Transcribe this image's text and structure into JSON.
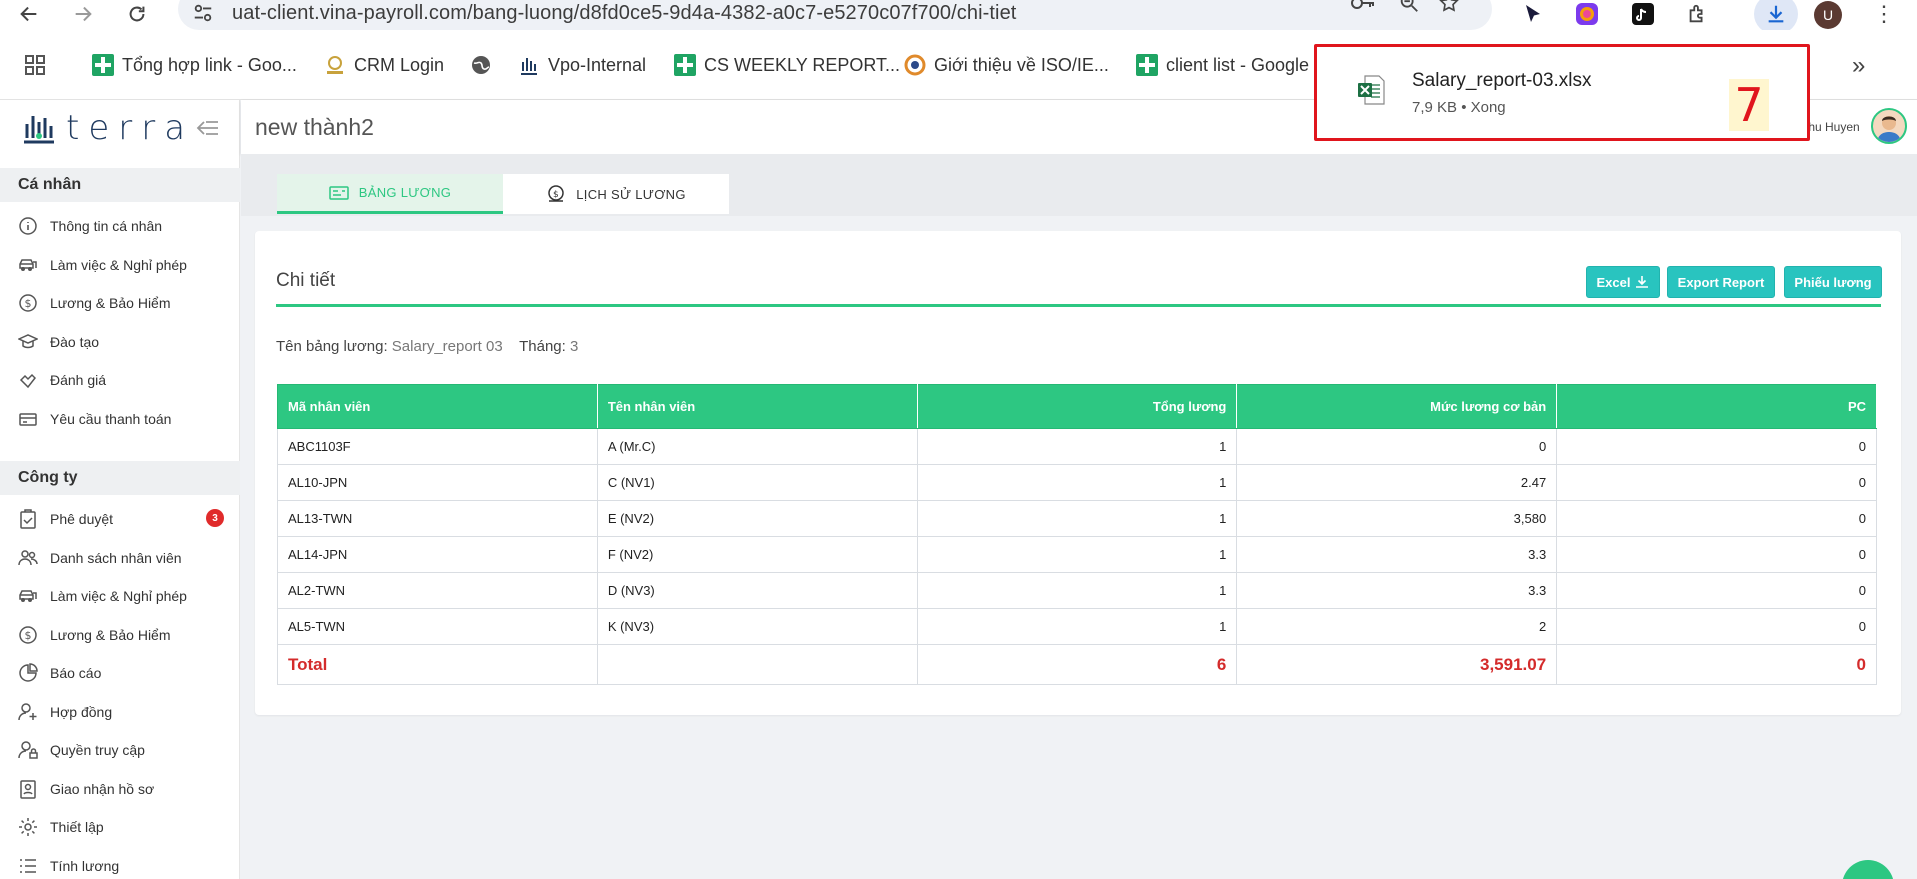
{
  "browser": {
    "url": "uat-client.vina-payroll.com/bang-luong/d8fd0ce5-9d4a-4382-a0c7-e5270c07f700/chi-tiet",
    "profile_initial": "U",
    "bookmarks": [
      {
        "label": "Tổng hợp link - Goo...",
        "icon": "sheets-icon"
      },
      {
        "label": "CRM Login",
        "icon": "crm-icon"
      },
      {
        "label": "",
        "icon": "globe-icon"
      },
      {
        "label": "Vpo-Internal",
        "icon": "terra-icon"
      },
      {
        "label": "CS WEEKLY REPORT...",
        "icon": "sheets-icon"
      },
      {
        "label": "Giới thiệu về ISO/IE...",
        "icon": "iso-icon"
      },
      {
        "label": "client list - Google",
        "icon": "sheets-icon"
      }
    ]
  },
  "download": {
    "file_name": "Salary_report-03.xlsx",
    "meta": "7,9 KB • Xong",
    "count": "7"
  },
  "app": {
    "logo_text": "terra",
    "page_title": "new thành2",
    "user_name": "Thu Huyen",
    "accent": "#2dc782"
  },
  "sidebar": {
    "personal_title": "Cá nhân",
    "personal": [
      {
        "label": "Thông tin cá nhân",
        "icon": "info-icon"
      },
      {
        "label": "Làm việc & Nghỉ phép",
        "icon": "car-icon"
      },
      {
        "label": "Lương & Bảo Hiểm",
        "icon": "money-icon"
      },
      {
        "label": "Đào tạo",
        "icon": "graduation-icon"
      },
      {
        "label": "Đánh giá",
        "icon": "review-icon"
      },
      {
        "label": "Yêu cầu thanh toán",
        "icon": "payment-icon"
      }
    ],
    "company_title": "Công ty",
    "company": [
      {
        "label": "Phê duyệt",
        "icon": "approval-icon",
        "badge": "3"
      },
      {
        "label": "Danh sách nhân viên",
        "icon": "people-icon"
      },
      {
        "label": "Làm việc & Nghỉ phép",
        "icon": "car-icon"
      },
      {
        "label": "Lương & Bảo Hiểm",
        "icon": "money-icon"
      },
      {
        "label": "Báo cáo",
        "icon": "pie-icon"
      },
      {
        "label": "Hợp đồng",
        "icon": "add-user-icon"
      },
      {
        "label": "Quyền truy cập",
        "icon": "user-lock-icon"
      },
      {
        "label": "Giao nhận hồ sơ",
        "icon": "profile-card-icon"
      },
      {
        "label": "Thiết lập",
        "icon": "gear-icon"
      },
      {
        "label": "Tính lương",
        "icon": "list-icon"
      }
    ]
  },
  "tabs": [
    {
      "label": "BẢNG LƯƠNG",
      "icon": "payslip-icon",
      "active": true
    },
    {
      "label": "LỊCH SỬ LƯƠNG",
      "icon": "money-history-icon",
      "active": false
    }
  ],
  "detail": {
    "title": "Chi tiết",
    "buttons": {
      "excel": "Excel",
      "export": "Export Report",
      "payslip": "Phiếu lương"
    },
    "name_label": "Tên bảng lương:",
    "name_value": "Salary_report 03",
    "month_label": "Tháng:",
    "month_value": "3"
  },
  "table": {
    "headers": [
      "Mã nhân viên",
      "Tên nhân viên",
      "Tổng lương",
      "Mức lương cơ bản",
      "PC"
    ],
    "rows": [
      [
        "ABC1103F",
        "A (Mr.C)",
        "1",
        "0",
        "0"
      ],
      [
        "AL10-JPN",
        "C (NV1)",
        "1",
        "2.47",
        "0"
      ],
      [
        "AL13-TWN",
        "E (NV2)",
        "1",
        "3,580",
        "0"
      ],
      [
        "AL14-JPN",
        "F (NV2)",
        "1",
        "3.3",
        "0"
      ],
      [
        "AL2-TWN",
        "D (NV3)",
        "1",
        "3.3",
        "0"
      ],
      [
        "AL5-TWN",
        "K (NV3)",
        "1",
        "2",
        "0"
      ]
    ],
    "total": [
      "Total",
      "",
      "6",
      "3,591.07",
      "0"
    ]
  }
}
